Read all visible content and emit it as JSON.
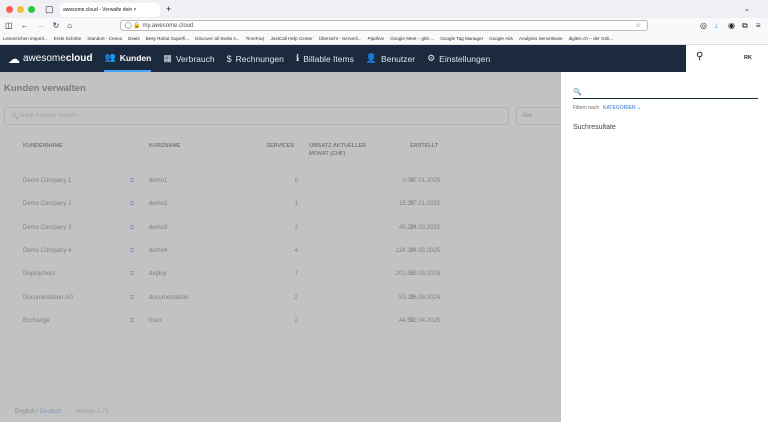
{
  "browser": {
    "tab_title": "awesome.cloud - Verwalte dein ×",
    "url": "my.awesome.cloud",
    "bookmarks": [
      "Lesezeichen importi...",
      "Erste Schritte",
      "Standort - Ceeva",
      "Deals",
      "Besy Robot Superfi...",
      "Discover all Swiss s...",
      "TimeFac|",
      "JustCall Help Center",
      "Übersicht - Serverli...",
      "Pipdrive",
      "Google Meet – gkb-...",
      "Google Tag Manager",
      "Google Ads",
      "Analytics ServerBase",
      "digitec.ch – der Onli..."
    ]
  },
  "app": {
    "logo_a": "awesome",
    "logo_b": "cloud",
    "nav": [
      {
        "icon": "users-icon",
        "glyph": "👥",
        "label": "Kunden",
        "active": true
      },
      {
        "icon": "chart-icon",
        "glyph": "▦",
        "label": "Verbrauch"
      },
      {
        "icon": "dollar-icon",
        "glyph": "$",
        "label": "Rechnungen"
      },
      {
        "icon": "info-icon",
        "glyph": "ℹ",
        "label": "Billable Items"
      },
      {
        "icon": "user-icon",
        "glyph": "👤",
        "label": "Benutzer"
      },
      {
        "icon": "gear-icon",
        "glyph": "⚙",
        "label": "Einstellungen"
      }
    ],
    "help": "?",
    "avatar": "RK"
  },
  "page": {
    "title": "Kunden verwalten",
    "search_placeholder": "Nach Kunden suchen...",
    "filter": "Alle",
    "columns": [
      "KUNDENNAME",
      "KURZNAME",
      "SERVICES",
      "UMSATZ AKTUELLER MONAT (CHF)",
      "ERSTELLT"
    ],
    "rows": [
      [
        "Demo Company 1",
        "demo1",
        "0",
        "0.00",
        "07.01.2025"
      ],
      [
        "Demo Company 2",
        "demo2",
        "1",
        "15.25",
        "07.01.2025"
      ],
      [
        "Demo Company 3",
        "demo3",
        "2",
        "45.20",
        "24.03.2025"
      ],
      [
        "Demo Company 4",
        "demo4",
        "4",
        "134.20",
        "24.03.2025"
      ],
      [
        "Deployment",
        "deploy",
        "7",
        "202.65",
        "19.03.2025"
      ],
      [
        "Documentation AG",
        "documentation",
        "2",
        "53.20",
        "26.08.2024"
      ],
      [
        "Exchange",
        "hoex",
        "2",
        "44.50",
        "02.04.2025"
      ]
    ],
    "lang_en": "English",
    "lang_sep": " / ",
    "lang_de": "Deutsch",
    "version": "Version 1.71"
  },
  "panel": {
    "filter_label": "Filtern nach",
    "filter_value": "KATEGORIEN",
    "results": "Suchresultate"
  }
}
